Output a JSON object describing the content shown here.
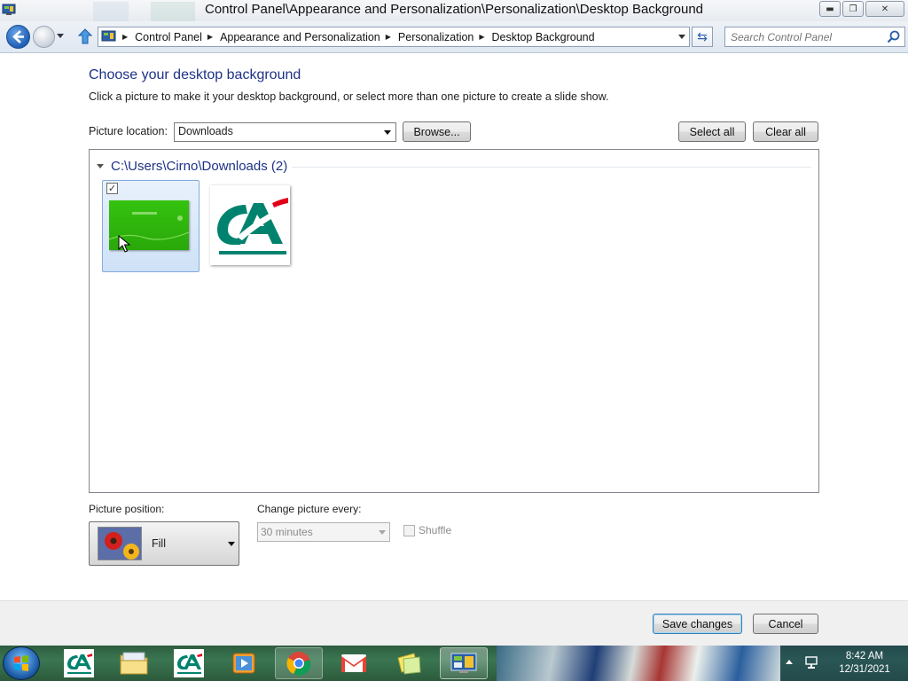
{
  "window": {
    "title": "Control Panel\\Appearance and Personalization\\Personalization\\Desktop Background",
    "controls": {
      "minimize": "▬",
      "maximize": "❐",
      "close": "✕"
    }
  },
  "address_bar": {
    "breadcrumbs": [
      "Control Panel",
      "Appearance and Personalization",
      "Personalization",
      "Desktop Background"
    ],
    "search_placeholder": "Search Control Panel"
  },
  "page": {
    "heading": "Choose your desktop background",
    "description": "Click a picture to make it your desktop background, or select more than one picture to create a slide show.",
    "picture_location_label": "Picture location:",
    "picture_location_value": "Downloads",
    "browse_label": "Browse...",
    "select_all_label": "Select all",
    "clear_all_label": "Clear all",
    "group_header": "C:\\Users\\Cirno\\Downloads (2)",
    "pictures": [
      {
        "name": "green-wallpaper",
        "selected": true
      },
      {
        "name": "credit-agricole-logo",
        "selected": false
      }
    ],
    "picture_position_label": "Picture position:",
    "picture_position_value": "Fill",
    "change_every_label": "Change picture every:",
    "change_every_value": "30 minutes",
    "shuffle_label": "Shuffle",
    "save_label": "Save changes",
    "cancel_label": "Cancel"
  },
  "taskbar": {
    "items": [
      "credit-agricole",
      "file-explorer",
      "credit-agricole",
      "media-player",
      "chrome",
      "gmail",
      "sticky-notes",
      "control-panel"
    ],
    "active_item": "control-panel",
    "time": "8:42 AM",
    "date": "12/31/2021"
  },
  "colors": {
    "heading": "#1e3287",
    "selection": "#cfe1f7",
    "taskbar": "#3a7651",
    "ca_green": "#00836e",
    "ca_red": "#e2001a"
  }
}
